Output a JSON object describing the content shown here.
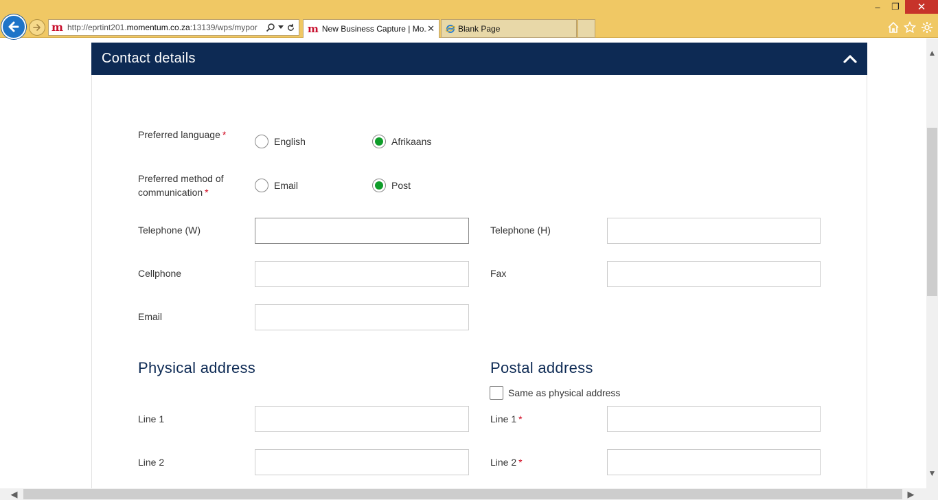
{
  "browser": {
    "url_prefix": "http://eprtint201.",
    "url_host": "momentum.co.za",
    "url_suffix": ":13139/wps/mypor",
    "site_logo": "m",
    "tabs": [
      {
        "title": "New Business Capture | Mo...",
        "active": true
      },
      {
        "title": "Blank Page",
        "active": false
      }
    ],
    "window_controls": {
      "minimize": "–",
      "restore": "❐",
      "close": "✕"
    }
  },
  "panel": {
    "title": "Contact details"
  },
  "form": {
    "preferred_language": {
      "label": "Preferred language",
      "required_mark": "*",
      "options": [
        {
          "label": "English",
          "selected": false
        },
        {
          "label": "Afrikaans",
          "selected": true
        }
      ]
    },
    "preferred_method": {
      "label_line1": "Preferred method of",
      "label_line2": "communication",
      "required_mark": "*",
      "options": [
        {
          "label": "Email",
          "selected": false
        },
        {
          "label": "Post",
          "selected": true
        }
      ]
    },
    "telephone_w": {
      "label": "Telephone (W)",
      "value": ""
    },
    "telephone_h": {
      "label": "Telephone (H)",
      "value": ""
    },
    "cellphone": {
      "label": "Cellphone",
      "value": ""
    },
    "fax": {
      "label": "Fax",
      "value": ""
    },
    "email": {
      "label": "Email",
      "value": ""
    }
  },
  "physical_address": {
    "title": "Physical address",
    "line1": {
      "label": "Line 1",
      "value": ""
    },
    "line2": {
      "label": "Line 2",
      "value": ""
    }
  },
  "postal_address": {
    "title": "Postal address",
    "same_as_physical": {
      "label": "Same as physical address",
      "checked": false
    },
    "line1": {
      "label": "Line 1",
      "required_mark": "*",
      "value": ""
    },
    "line2": {
      "label": "Line 2",
      "required_mark": "*",
      "value": ""
    }
  },
  "colors": {
    "header_bg": "#0d2a54",
    "radio_selected": "#0f9d2a",
    "required": "#d0021b",
    "chrome": "#f0c864"
  }
}
